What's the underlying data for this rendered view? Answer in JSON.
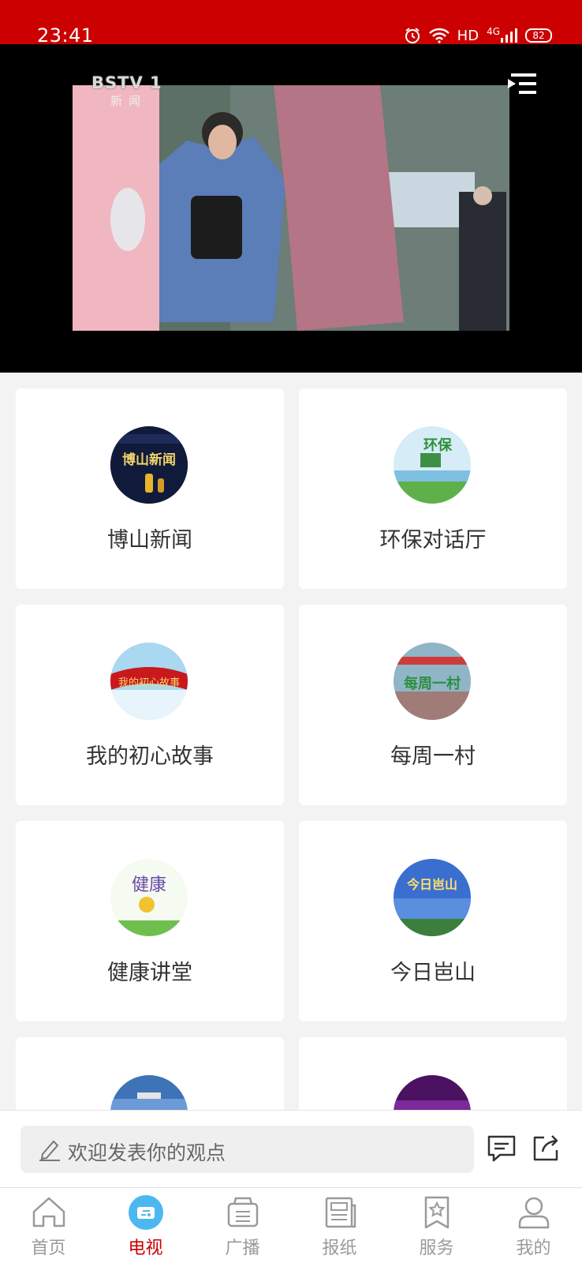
{
  "status_bar": {
    "time": "23:41",
    "network": "HD",
    "signal_type": "4G",
    "battery": "82"
  },
  "video": {
    "channel_logo": "BSTV 1",
    "channel_sub": "新闻"
  },
  "programs": [
    {
      "label": "博山新闻",
      "thumb_text": "博山新闻"
    },
    {
      "label": "环保对话厅",
      "thumb_text": "环保"
    },
    {
      "label": "我的初心故事",
      "thumb_text": "我的初心故事"
    },
    {
      "label": "每周一村",
      "thumb_text": "每周一村"
    },
    {
      "label": "健康讲堂",
      "thumb_text": "健康"
    },
    {
      "label": "今日岜山",
      "thumb_text": "今日岜山"
    },
    {
      "label": "",
      "thumb_text": ""
    },
    {
      "label": "",
      "thumb_text": ""
    }
  ],
  "comment_bar": {
    "placeholder": "欢迎发表你的观点"
  },
  "tabs": [
    {
      "label": "首页",
      "icon": "home-icon"
    },
    {
      "label": "电视",
      "icon": "tv-icon"
    },
    {
      "label": "广播",
      "icon": "radio-icon"
    },
    {
      "label": "报纸",
      "icon": "newspaper-icon"
    },
    {
      "label": "服务",
      "icon": "service-icon"
    },
    {
      "label": "我的",
      "icon": "profile-icon"
    }
  ],
  "colors": {
    "brand": "#cc0000",
    "tab_active_bg": "#4db8f0",
    "tab_inactive": "#9a9a9a"
  }
}
